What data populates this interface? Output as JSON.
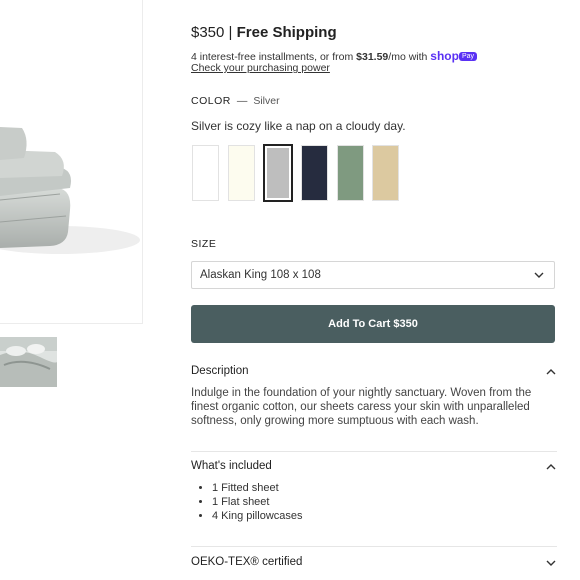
{
  "pricing": {
    "price": "$350",
    "separator": "|",
    "shipping": "Free Shipping",
    "installments_prefix": "4 interest-free installments, or from",
    "installment_amount": "$31.59",
    "installments_suffix": "/mo with",
    "shop_label": "shop",
    "pay_label": "Pay",
    "check_power_link": "Check your purchasing power"
  },
  "color": {
    "label": "COLOR",
    "dash": "—",
    "selected_name": "Silver",
    "description": "Silver is cozy like a nap on a cloudy day.",
    "swatches": [
      {
        "name": "White",
        "hex": "#ffffff",
        "selected": false
      },
      {
        "name": "Ivory",
        "hex": "#fdfcef",
        "selected": false
      },
      {
        "name": "Silver",
        "hex": "#bebebe",
        "selected": true
      },
      {
        "name": "Navy",
        "hex": "#262c3f",
        "selected": false
      },
      {
        "name": "Sage",
        "hex": "#7f9a80",
        "selected": false
      },
      {
        "name": "Sand",
        "hex": "#dcc9a0",
        "selected": false
      }
    ]
  },
  "size": {
    "label": "SIZE",
    "selected": "Alaskan King 108 x 108"
  },
  "cart": {
    "button_label": "Add To Cart $350",
    "button_color": "#4a5e60"
  },
  "accordions": {
    "description": {
      "title": "Description",
      "expanded": true,
      "text": "Indulge in the foundation of your nightly sanctuary. Woven from the finest organic cotton, our sheets caress your skin with unparalleled softness, only growing more sumptuous with each wash."
    },
    "included": {
      "title": "What's included",
      "expanded": true,
      "items": [
        "1 Fitted sheet",
        "1 Flat sheet",
        "4 King pillowcases"
      ]
    },
    "oekotex": {
      "title": "OEKO-TEX® certified",
      "expanded": false
    }
  }
}
